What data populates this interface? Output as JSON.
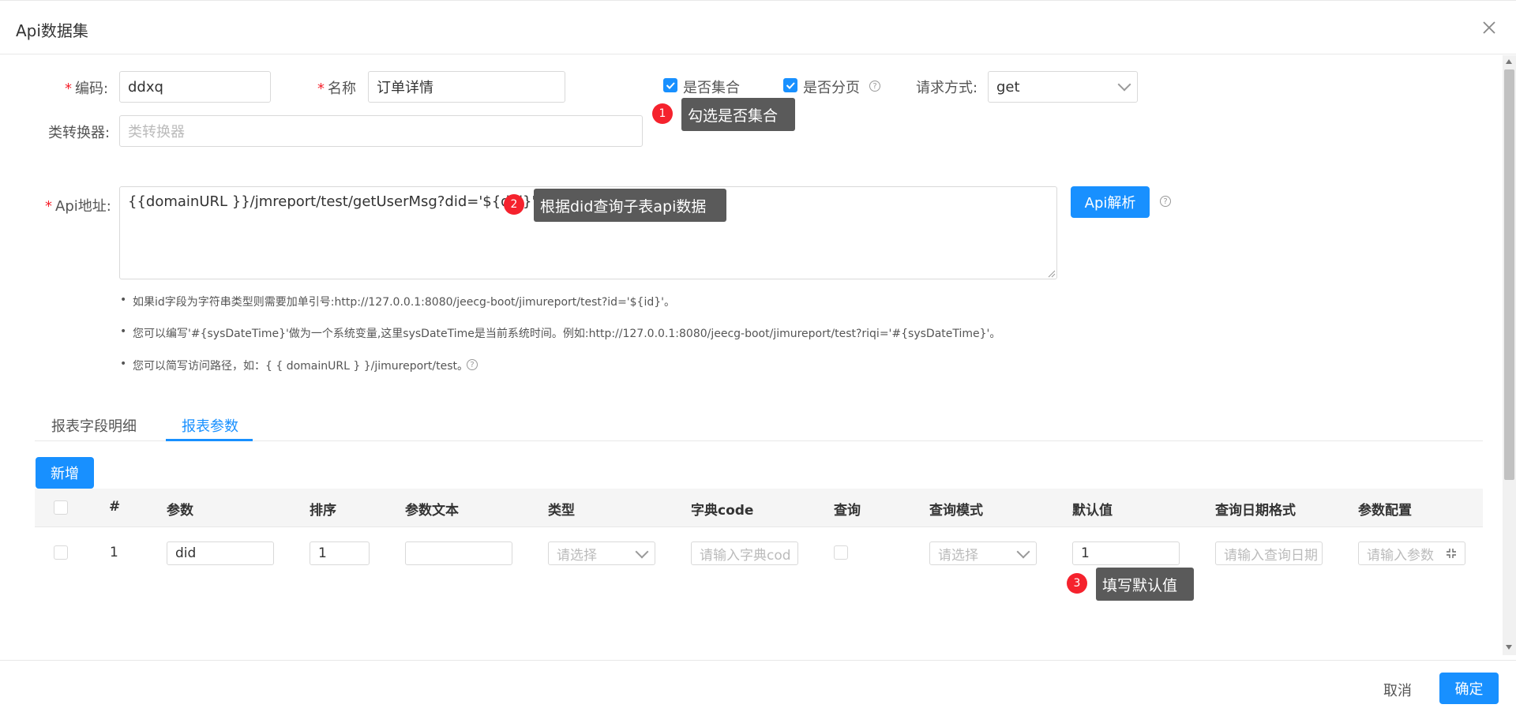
{
  "dialog": {
    "title": "Api数据集"
  },
  "form": {
    "code_label": "编码:",
    "code_value": "ddxq",
    "name_label": "名称",
    "name_value": "订单详情",
    "is_collection_label": "是否集合",
    "is_paging_label": "是否分页",
    "method_label": "请求方式:",
    "method_value": "get",
    "converter_label": "类转换器:",
    "converter_placeholder": "类转换器",
    "api_label": "Api地址:",
    "api_value": "{{domainURL }}/jmreport/test/getUserMsg?did='${did}'",
    "parse_button": "Api解析"
  },
  "notes": [
    "如果id字段为字符串类型则需要加单引号:http://127.0.0.1:8080/jeecg-boot/jimureport/test?id='${id}'。",
    "您可以编写'#{sysDateTime}'做为一个系统变量,这里sysDateTime是当前系统时间。例如:http://127.0.0.1:8080/jeecg-boot/jimureport/test?riqi='#{sysDateTime}'。",
    "您可以简写访问路径，如：{ { domainURL } }/jimureport/test。"
  ],
  "tabs": [
    {
      "label": "报表字段明细"
    },
    {
      "label": "报表参数"
    }
  ],
  "toolbar": {
    "add_label": "新增"
  },
  "table": {
    "headers": [
      "#",
      "参数",
      "排序",
      "参数文本",
      "类型",
      "字典code",
      "查询",
      "查询模式",
      "默认值",
      "查询日期格式",
      "参数配置"
    ],
    "row": {
      "index": "1",
      "param": "did",
      "order": "1",
      "param_text": "",
      "type_placeholder": "请选择",
      "dict_placeholder": "请输入字典cod",
      "mode_placeholder": "请选择",
      "default_value": "1",
      "date_placeholder": "请输入查询日期",
      "config_placeholder": "请输入参数"
    }
  },
  "annotations": [
    {
      "num": "1",
      "text": "勾选是否集合"
    },
    {
      "num": "2",
      "text": "根据did查询子表api数据"
    },
    {
      "num": "3",
      "text": "填写默认值"
    }
  ],
  "footer": {
    "cancel_label": "取消",
    "ok_label": "确定"
  },
  "colors": {
    "primary": "#1890ff",
    "required": "#f5222d",
    "tooltip": "#5a5a5a"
  }
}
